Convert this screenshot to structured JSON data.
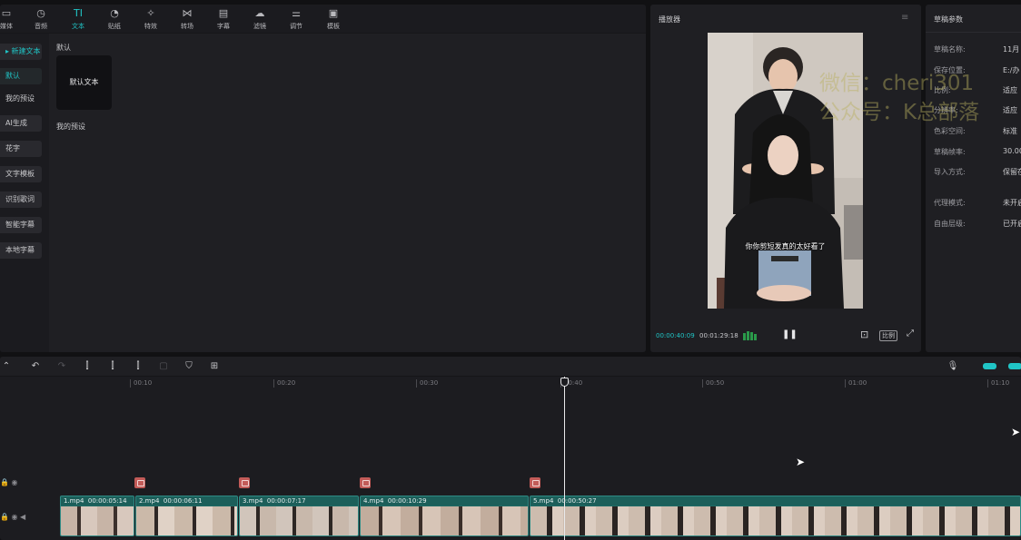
{
  "toolbar": {
    "items": [
      {
        "label": "媒体",
        "icon": "media-icon"
      },
      {
        "label": "音频",
        "icon": "audio-icon"
      },
      {
        "label": "文本",
        "icon": "text-icon"
      },
      {
        "label": "贴纸",
        "icon": "sticker-icon"
      },
      {
        "label": "特效",
        "icon": "effects-icon"
      },
      {
        "label": "转场",
        "icon": "transition-icon"
      },
      {
        "label": "字幕",
        "icon": "subtitle-icon"
      },
      {
        "label": "滤镜",
        "icon": "filter-icon"
      },
      {
        "label": "调节",
        "icon": "adjust-icon"
      },
      {
        "label": "模板",
        "icon": "template-icon"
      }
    ],
    "active": "文本"
  },
  "sidebar": {
    "items": [
      {
        "label": "▸ 新建文本"
      },
      {
        "label": "默认"
      },
      {
        "label": "我的预设"
      },
      {
        "label": "AI生成"
      },
      {
        "label": "花字"
      },
      {
        "label": "文字模板"
      },
      {
        "label": "识别歌词"
      },
      {
        "label": "智能字幕"
      },
      {
        "label": "本地字幕"
      }
    ]
  },
  "library": {
    "section_default": "默认",
    "card_label": "默认文本",
    "section_presets": "我的预设"
  },
  "player": {
    "title": "播放器",
    "subtitle_text": "你你剪短发真的太好看了",
    "current_time": "00:00:40:09",
    "total_time": "00:01:29:18",
    "ratio_label": "比例"
  },
  "watermark": {
    "line1": "微信：cheri301",
    "line2": "公众号：K总部落"
  },
  "params": {
    "title": "草稿参数",
    "rows": [
      {
        "label": "草稿名称:",
        "value": "11月"
      },
      {
        "label": "保存位置:",
        "value": "E:/办"
      },
      {
        "label": "比例:",
        "value": "适应"
      },
      {
        "label": "分辨率:",
        "value": "适应"
      },
      {
        "label": "色彩空间:",
        "value": "标准"
      },
      {
        "label": "草稿帧率:",
        "value": "30.00"
      },
      {
        "label": "导入方式:",
        "value": "保留在"
      },
      {
        "label": "代理模式:",
        "value": "未开启"
      },
      {
        "label": "自由层级:",
        "value": "已开启"
      }
    ]
  },
  "timeline": {
    "ruler": [
      "00:10",
      "00:20",
      "00:30",
      "00:40",
      "00:50",
      "01:00",
      "01:10"
    ],
    "clips": [
      {
        "name": "1.mp4",
        "duration": "00:00:05:14"
      },
      {
        "name": "2.mp4",
        "duration": "00:00:06:11"
      },
      {
        "name": "3.mp4",
        "duration": "00:00:07:17"
      },
      {
        "name": "4.mp4",
        "duration": "00:00:10:29"
      },
      {
        "name": "5.mp4",
        "duration": "00:00:50:27"
      }
    ]
  },
  "colors": {
    "accent": "#20c5c6",
    "clip": "#1e6b66",
    "marker": "#c25b58"
  }
}
